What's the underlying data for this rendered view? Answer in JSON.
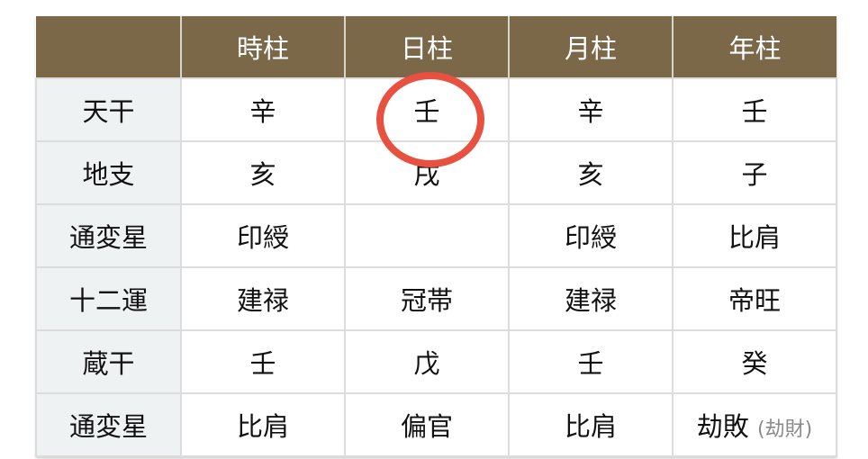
{
  "table": {
    "columns": [
      "",
      "時柱",
      "日柱",
      "月柱",
      "年柱"
    ],
    "rows": [
      {
        "label": "天干",
        "cells": [
          "辛",
          "壬",
          "辛",
          "壬"
        ]
      },
      {
        "label": "地支",
        "cells": [
          "亥",
          "戌",
          "亥",
          "子"
        ]
      },
      {
        "label": "通変星",
        "cells": [
          "印綬",
          "",
          "印綬",
          "比肩"
        ]
      },
      {
        "label": "十二運",
        "cells": [
          "建禄",
          "冠帯",
          "建禄",
          "帝旺"
        ]
      },
      {
        "label": "蔵干",
        "cells": [
          "壬",
          "戊",
          "壬",
          "癸"
        ]
      },
      {
        "label": "通変星",
        "cells": [
          "比肩",
          "偏官",
          "比肩",
          "劫敗"
        ],
        "notes": [
          "",
          "",
          "",
          "(劫財)"
        ]
      }
    ]
  },
  "highlight": {
    "target": "日柱 天干",
    "color": "#e8513f"
  }
}
